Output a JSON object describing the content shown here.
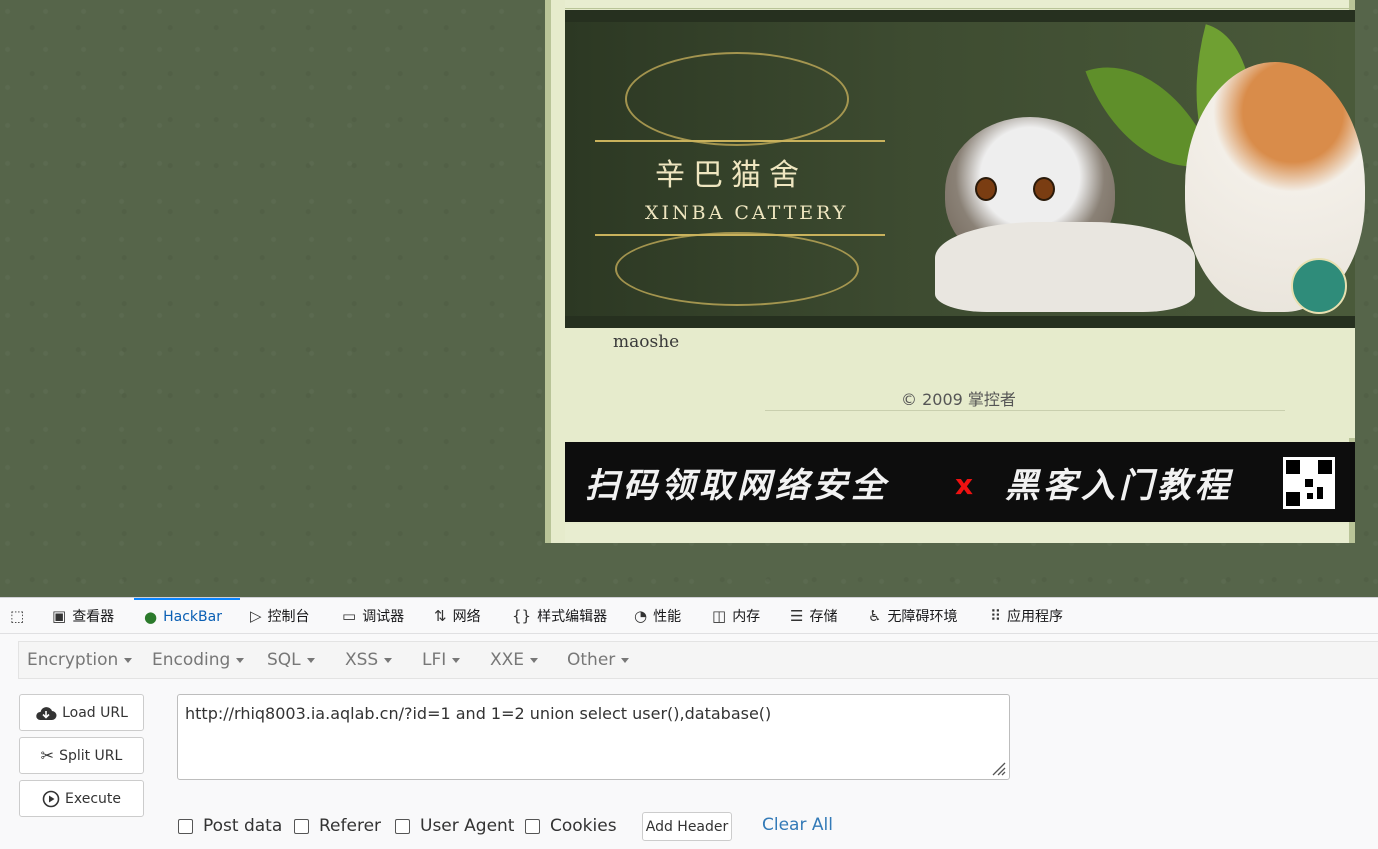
{
  "site": {
    "banner_title_cn": "辛巴猫舍",
    "banner_title_en": "XINBA CATTERY",
    "site_name": "maoshe",
    "copyright": "© 2009 掌控者",
    "ad_text_left": "扫码领取网络安全",
    "ad_x": "x",
    "ad_text_right": "黑客入门教程"
  },
  "devtools": {
    "tabs": [
      {
        "label": "查看器",
        "icon": "inspector-icon"
      },
      {
        "label": "HackBar",
        "icon": "hackbar-icon",
        "active": true
      },
      {
        "label": "控制台",
        "icon": "console-icon"
      },
      {
        "label": "调试器",
        "icon": "debugger-icon"
      },
      {
        "label": "网络",
        "icon": "network-icon"
      },
      {
        "label": "样式编辑器",
        "icon": "style-editor-icon"
      },
      {
        "label": "性能",
        "icon": "performance-icon"
      },
      {
        "label": "内存",
        "icon": "memory-icon"
      },
      {
        "label": "存储",
        "icon": "storage-icon"
      },
      {
        "label": "无障碍环境",
        "icon": "accessibility-icon"
      },
      {
        "label": "应用程序",
        "icon": "application-icon"
      }
    ],
    "accent_color": "#0a84ff"
  },
  "hackbar": {
    "menus": [
      "Encryption",
      "Encoding",
      "SQL",
      "XSS",
      "LFI",
      "XXE",
      "Other"
    ],
    "load_url": "Load URL",
    "split_url": "Split URL",
    "execute": "Execute",
    "url_value": "http://rhiq8003.ia.aqlab.cn/?id=1 and 1=2 union select user(),database()",
    "post_data": "Post data",
    "referer": "Referer",
    "user_agent": "User Agent",
    "cookies": "Cookies",
    "add_header": "Add Header",
    "clear_all": "Clear All"
  }
}
